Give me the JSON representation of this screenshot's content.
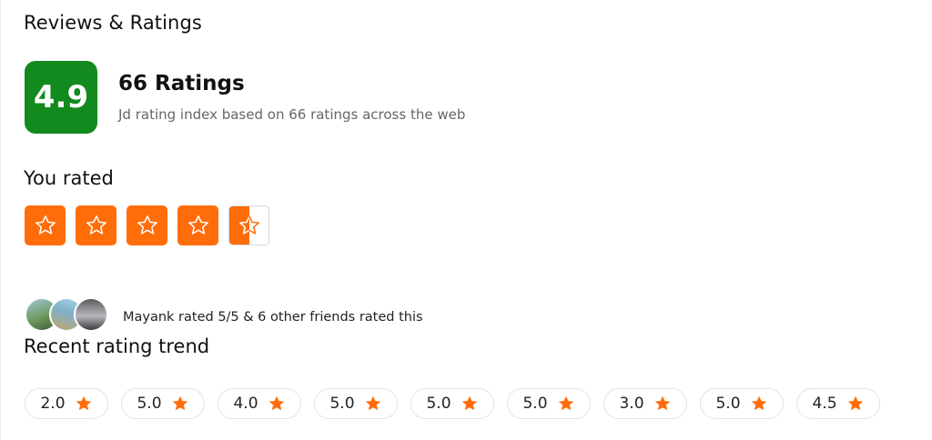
{
  "section_title": "Reviews & Ratings",
  "score": {
    "value": "4.9",
    "bg": "#138a1d",
    "fg": "#ffffff"
  },
  "ratings": {
    "count_label": "66 Ratings",
    "description": "Jd rating index based on 66 ratings across the web"
  },
  "you_rated": {
    "label": "You rated",
    "value": 4.5,
    "max": 5,
    "accent": "#ff6d0a"
  },
  "friends": {
    "avatars": [
      "avatar-1",
      "avatar-2",
      "avatar-3"
    ],
    "text": "Mayank rated 5/5 & 6 other friends rated this"
  },
  "trend": {
    "title": "Recent rating trend",
    "items": [
      "2.0",
      "5.0",
      "4.0",
      "5.0",
      "5.0",
      "5.0",
      "3.0",
      "5.0",
      "4.5"
    ],
    "star_color": "#ff6d0a",
    "icon": "star-icon"
  }
}
